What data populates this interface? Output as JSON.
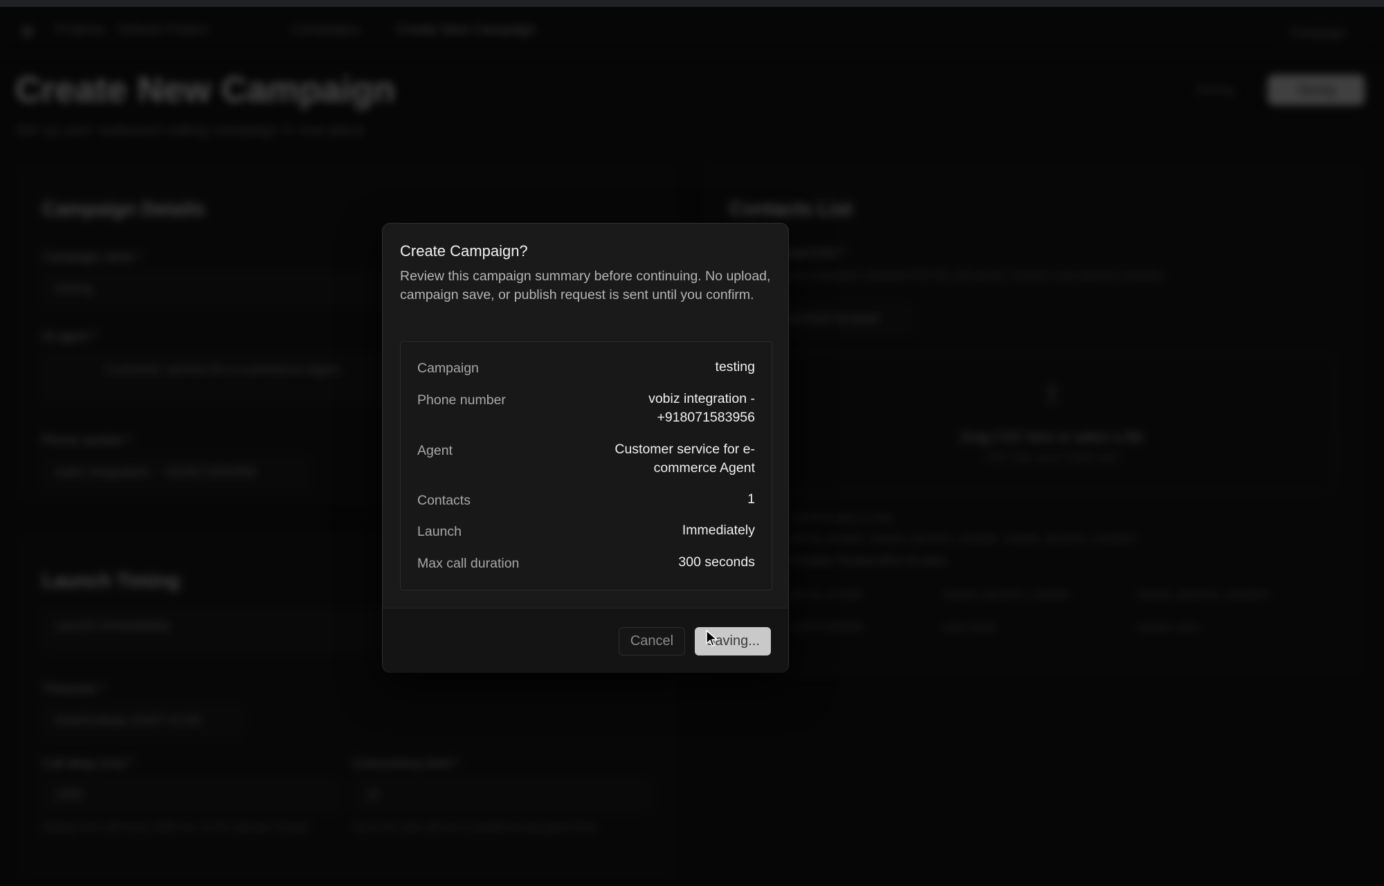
{
  "dialog": {
    "title": "Create Campaign?",
    "description": "Review this campaign summary before continuing. No upload, campaign save, or publish request is sent until you confirm.",
    "summary": [
      {
        "label": "Campaign",
        "value": "testing"
      },
      {
        "label": "Phone number",
        "value": "vobiz integration - +918071583956"
      },
      {
        "label": "Agent",
        "value": "Customer service for e-commerce Agent"
      },
      {
        "label": "Contacts",
        "value": "1"
      },
      {
        "label": "Launch",
        "value": "Immediately"
      },
      {
        "label": "Max call duration",
        "value": "300 seconds"
      }
    ],
    "cancel_label": "Cancel",
    "confirm_label": "Saving..."
  },
  "background": {
    "breadcrumb": [
      "Projects",
      "Default Project",
      "Campaigns",
      "Create New Campaign"
    ],
    "topbar_right": "Campaign",
    "page_title": "Create New Campaign",
    "page_subtitle": "Set up your outbound calling campaign in one place",
    "header_buttons": {
      "secondary": "Saving",
      "primary": "Saving"
    },
    "campaign_details": {
      "title": "Campaign Details",
      "name_label": "Campaign name *",
      "name_value": "testing",
      "agent_label": "AI agent *",
      "agent_value": "Customer service for e-commerce Agent",
      "phone_label": "Phone number *",
      "phone_value": "vobiz integration - +918071583956"
    },
    "launch_timing": {
      "title": "Launch Timing",
      "launch_value": "Launch immediately",
      "timezone_label": "Timezone *",
      "timezone_value": "Asia/Kolkata (GMT+5:30)",
      "delay_label": "Call delay (ms) *",
      "delay_value": "1000",
      "delay_hint": "Dialing runs will every 1000 ms, so 61 calls per minute",
      "concurrency_label": "Concurrency limit *",
      "concurrency_value": "15",
      "concurrency_hint": "Up to 15 calls will run in parallel at any given time"
    },
    "contacts": {
      "title": "Contacts List",
      "upload_label": "Upload CSV *",
      "upload_hint": "Upload a template-validated CSV file with phone numbers and optional variables",
      "template_button": "Download template",
      "drop_title": "Drag CSV here or select a file",
      "drop_sub": "CSV only, up to 5,000 rows",
      "preview_heading": "CSV Preview (1 row)",
      "preview_columns": "phone_number, sample_dynamic_variable, sample_dynamic_variable2",
      "preview_rows_label": "Contacts Preview (first 10 rows)",
      "preview_col1": "phone_number",
      "preview_col2": "sample_dynamic_variable",
      "preview_col3": "sample_dynamic_variable2",
      "preview_val1": "918071583956",
      "preview_val2": "sales leads",
      "preview_val3": "sample value"
    }
  }
}
